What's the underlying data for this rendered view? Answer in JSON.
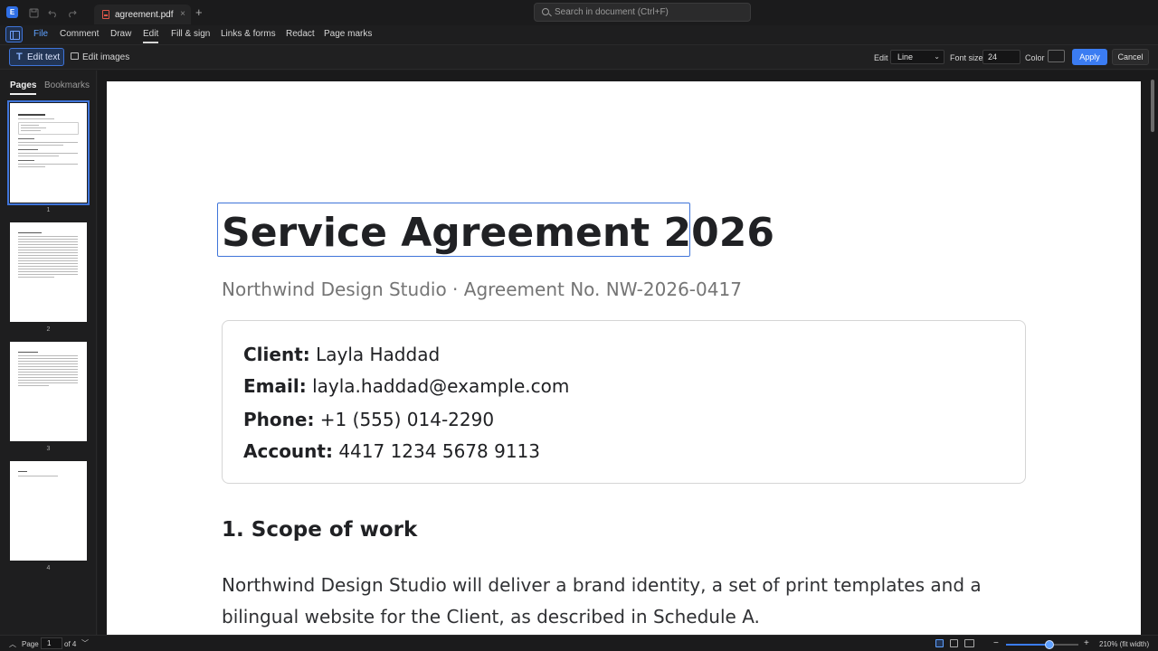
{
  "titlebar": {
    "app_icon_letter": "E",
    "tab_title": "agreement.pdf",
    "tab_close": "×",
    "new_tab": "+",
    "search_placeholder": "Search in document (Ctrl+F)"
  },
  "menu": {
    "items": [
      "File",
      "Comment",
      "Draw",
      "Edit",
      "Fill & sign",
      "Links & forms",
      "Redact",
      "Page marks"
    ],
    "active": "Edit"
  },
  "toolbar": {
    "edit_text_label": "Edit text",
    "edit_images_label": "Edit images",
    "edit_label": "Edit",
    "edit_mode_value": "Line",
    "font_size_label": "Font size",
    "font_size_value": "24",
    "color_label": "Color",
    "color_value": "#1c1c1d",
    "apply_label": "Apply",
    "cancel_label": "Cancel"
  },
  "sidebar": {
    "tabs": [
      "Pages",
      "Bookmarks"
    ],
    "active_tab": "Pages",
    "page_numbers": [
      "1",
      "2",
      "3",
      "4"
    ],
    "selected_page": 1
  },
  "document": {
    "title": "Service Agreement 2026",
    "subtitle": "Northwind Design Studio · Agreement No. NW-2026-0417",
    "info": [
      {
        "label": "Client:",
        "value": "Layla Haddad"
      },
      {
        "label": "Email:",
        "value": "layla.haddad@example.com"
      },
      {
        "label": "Phone:",
        "value": "+1 (555) 014-2290"
      },
      {
        "label": "Account:",
        "value": "4417 1234 5678 9113"
      }
    ],
    "section_heading": "1. Scope of work",
    "paragraph": "Northwind Design Studio will deliver a brand identity, a set of print templates and a bilingual website for the Client, as described in Schedule A."
  },
  "statusbar": {
    "page_label": "Page",
    "page_value": "1",
    "page_of": "of 4",
    "zoom_label": "210% (fit width)",
    "zoom_level_fraction": 0.6
  },
  "colors": {
    "accent": "#3b7cf2",
    "selection": "#3f74d9",
    "background": "#1e1e1f"
  }
}
